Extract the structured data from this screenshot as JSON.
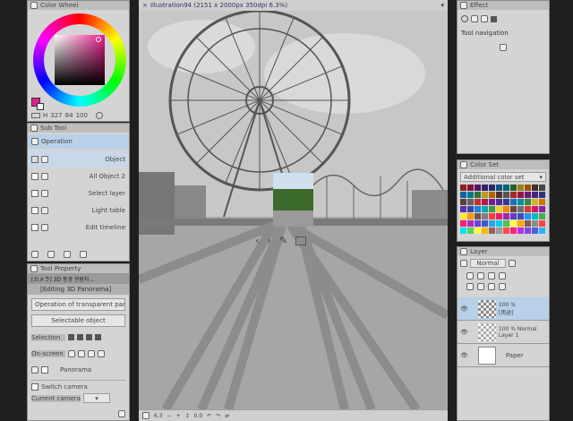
{
  "color_wheel": {
    "title": "Color Wheel",
    "hsv": {
      "h": "327",
      "s": "84",
      "v": "100"
    }
  },
  "sub_tool": {
    "title": "Sub Tool",
    "group": "Operation",
    "items": [
      "Object",
      "All Object 2",
      "Select layer",
      "Light table",
      "Edit timeline"
    ]
  },
  "tool_property": {
    "title": "Tool Property",
    "name": "[カメラ] 3D 풍경 관람차...",
    "mode": "[Editing 3D Panorama]",
    "rows": [
      "Operation of transparent part",
      "Selectable object",
      "Selection",
      "On-screen man...",
      "Panorama"
    ],
    "switch_camera": "Switch camera",
    "current_camera": "Current camera"
  },
  "canvas": {
    "tab_title": "Illustration94 (2151 x 2000px 350dpi 6.3%)",
    "zoom": "6.3",
    "angle": "0.0"
  },
  "effect": {
    "title": "Effect"
  },
  "tool_navigation": {
    "title": "Tool navigation"
  },
  "color_set": {
    "title": "Color Set",
    "set_name": "Additional color set"
  },
  "layer": {
    "title": "Layer",
    "blend": "Normal",
    "layers": [
      {
        "pct": "100 %",
        "name": "[用途]",
        "thumb": "checker"
      },
      {
        "pct": "100 % Normal",
        "name": "Layer 1",
        "thumb": "checker"
      },
      {
        "pct": "",
        "name": "Paper",
        "thumb": "white"
      }
    ]
  },
  "colors": {
    "accent": "#e91e8c",
    "highlight": "#b8d0e8",
    "panel": "#d4d4d4"
  }
}
